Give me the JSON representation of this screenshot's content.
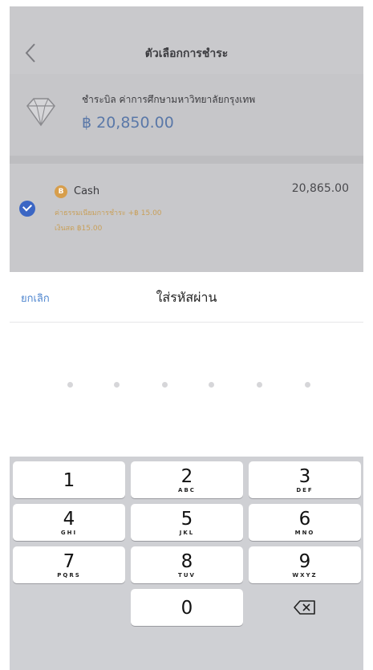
{
  "nav": {
    "title": "ตัวเลือกการชำระ",
    "back_icon": "chevron-left-icon"
  },
  "bill": {
    "description": "ชำระบิล ค่าการศึกษามหาวิทยาลัยกรุงเทพ",
    "amount": "฿ 20,850.00",
    "icon": "diamond-icon"
  },
  "method": {
    "coin": "B",
    "name": "Cash",
    "amount": "20,865.00",
    "fee_note": "ค่าธรรมเนียมการชำระ +฿ 15.00",
    "balance_note": "เงินสด ฿15.00"
  },
  "sheet": {
    "cancel_label": "ยกเลิก",
    "title": "ใส่รหัสผ่าน",
    "pin_length": 6
  },
  "keypad": {
    "keys": [
      {
        "digit": "1",
        "letters": ""
      },
      {
        "digit": "2",
        "letters": "ABC"
      },
      {
        "digit": "3",
        "letters": "DEF"
      },
      {
        "digit": "4",
        "letters": "GHI"
      },
      {
        "digit": "5",
        "letters": "JKL"
      },
      {
        "digit": "6",
        "letters": "MNO"
      },
      {
        "digit": "7",
        "letters": "PQRS"
      },
      {
        "digit": "8",
        "letters": "TUV"
      },
      {
        "digit": "9",
        "letters": "WXYZ"
      },
      {
        "digit": "0",
        "letters": ""
      }
    ],
    "backspace_icon": "backspace-icon"
  },
  "colors": {
    "accent": "#4f86cf",
    "check": "#3b66c4",
    "coin": "#d79e4c",
    "fee_text": "#c9a05a"
  }
}
